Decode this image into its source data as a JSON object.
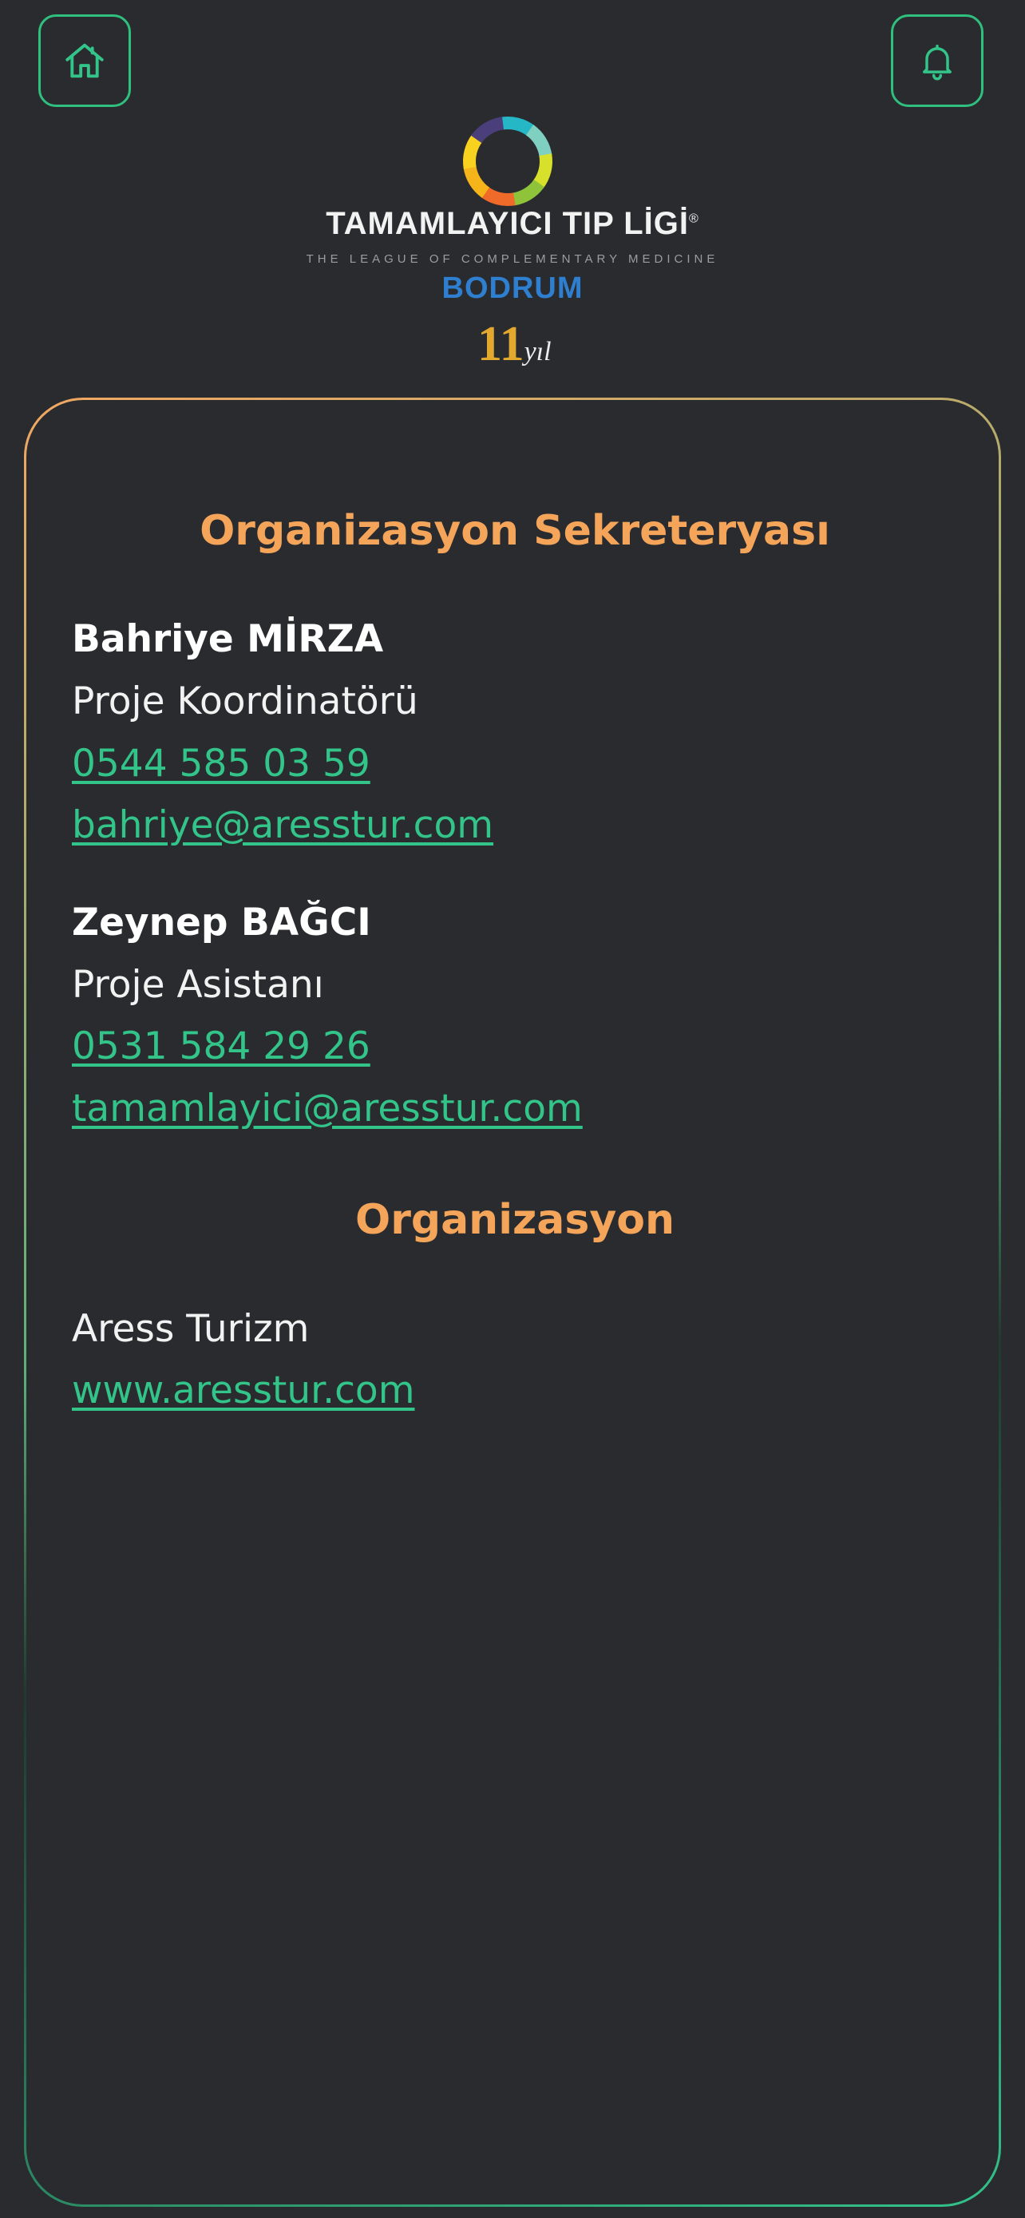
{
  "header": {
    "home_icon": "home-icon",
    "bell_icon": "bell-icon"
  },
  "logo": {
    "title": "TAMAMLAYICI TIP LİGİ",
    "registered": "®",
    "subtitle": "THE LEAGUE OF COMPLEMENTARY MEDICINE",
    "city": "BODRUM",
    "year_number": "11",
    "year_suffix": "yıl"
  },
  "secretariat": {
    "title": "Organizasyon Sekreteryası",
    "contacts": [
      {
        "name": "Bahriye MİRZA",
        "role": "Proje Koordinatörü",
        "phone": "0544 585 03 59",
        "email": "bahriye@aresstur.com"
      },
      {
        "name": "Zeynep BAĞCI",
        "role": "Proje Asistanı",
        "phone": "0531 584 29 26",
        "email": "tamamlayici@aresstur.com"
      }
    ]
  },
  "organization": {
    "title": "Organizasyon",
    "company": "Aress Turizm",
    "website": "www.aresstur.com"
  },
  "colors": {
    "background": "#2a2b2f",
    "accent_green": "#32c489",
    "accent_orange": "#f5a55a",
    "logo_blue": "#2f7fd0",
    "logo_gold": "#e3a92e"
  }
}
